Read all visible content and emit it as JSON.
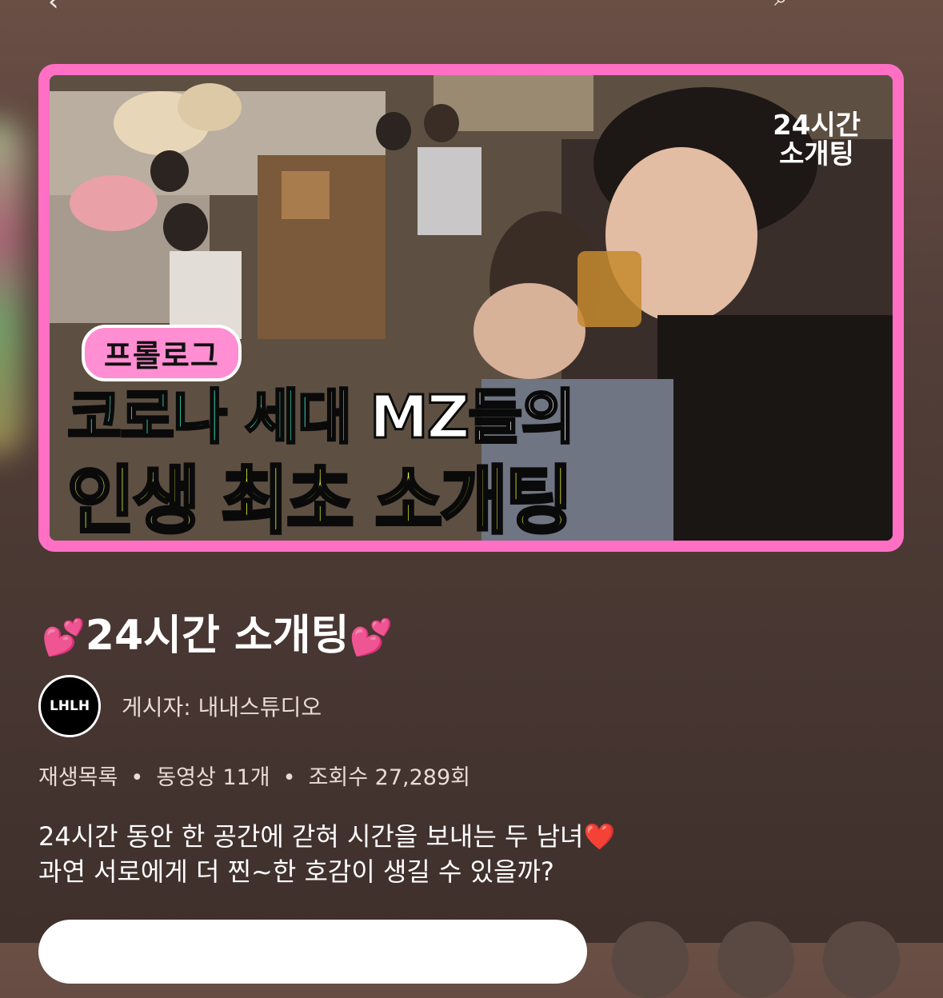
{
  "topbar": {
    "back_icon": "‹",
    "search_icon": "⌕"
  },
  "thumbnail": {
    "brand_num": "24",
    "brand_word1": "시간",
    "brand_word2": "소개팅",
    "pill_label": "프롤로그",
    "headline1_a": "코로나 세대 ",
    "headline1_b": "MZ들의",
    "headline2": "인생 최초 소개팅",
    "border_color": "#ff6fc4"
  },
  "playlist": {
    "title": "24시간 소개팅",
    "title_emoji_left": "💕",
    "title_emoji_right": "💕",
    "channel_avatar_text": "LHLH",
    "channel_label": "게시자: 내내스튜디오",
    "meta_type": "재생목록",
    "meta_videos": "동영상 11개",
    "meta_views": "조회수 27,289회",
    "meta_dot": "•",
    "desc_line1": "24시간 동안 한 공간에 갇혀 시간을 보내는 두 남녀",
    "desc_heart": "❤️",
    "desc_line2": "과연 서로에게 더 찐~한 호감이 생길 수 있을까?"
  }
}
